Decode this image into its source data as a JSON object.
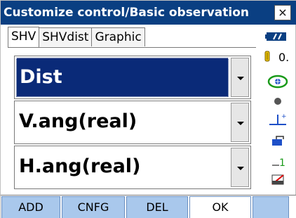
{
  "window": {
    "title": "Customize control/Basic observation",
    "close_label": "×"
  },
  "tabs": [
    {
      "label": "SHV",
      "active": true
    },
    {
      "label": "SHVdist",
      "active": false
    },
    {
      "label": "Graphic",
      "active": false
    }
  ],
  "rows": [
    {
      "value": "Dist",
      "selected": true
    },
    {
      "value": "V.ang(real)",
      "selected": false
    },
    {
      "value": "H.ang(real)",
      "selected": false
    }
  ],
  "status": {
    "angle_readout": "0.",
    "icons": [
      "battery-icon",
      "prism-icon",
      "target-icon",
      "laser-point-icon",
      "tilt-icon",
      "bluetooth-icon",
      "input-mode-icon",
      "memory-icon"
    ]
  },
  "softkeys": [
    "ADD",
    "CNFG",
    "DEL",
    "OK",
    ""
  ],
  "colors": {
    "title_bg": "#0a3f82",
    "selected_bg": "#0a2a78",
    "softkey_bg": "#a9c8ec",
    "accent_green": "#1a9a1a"
  }
}
